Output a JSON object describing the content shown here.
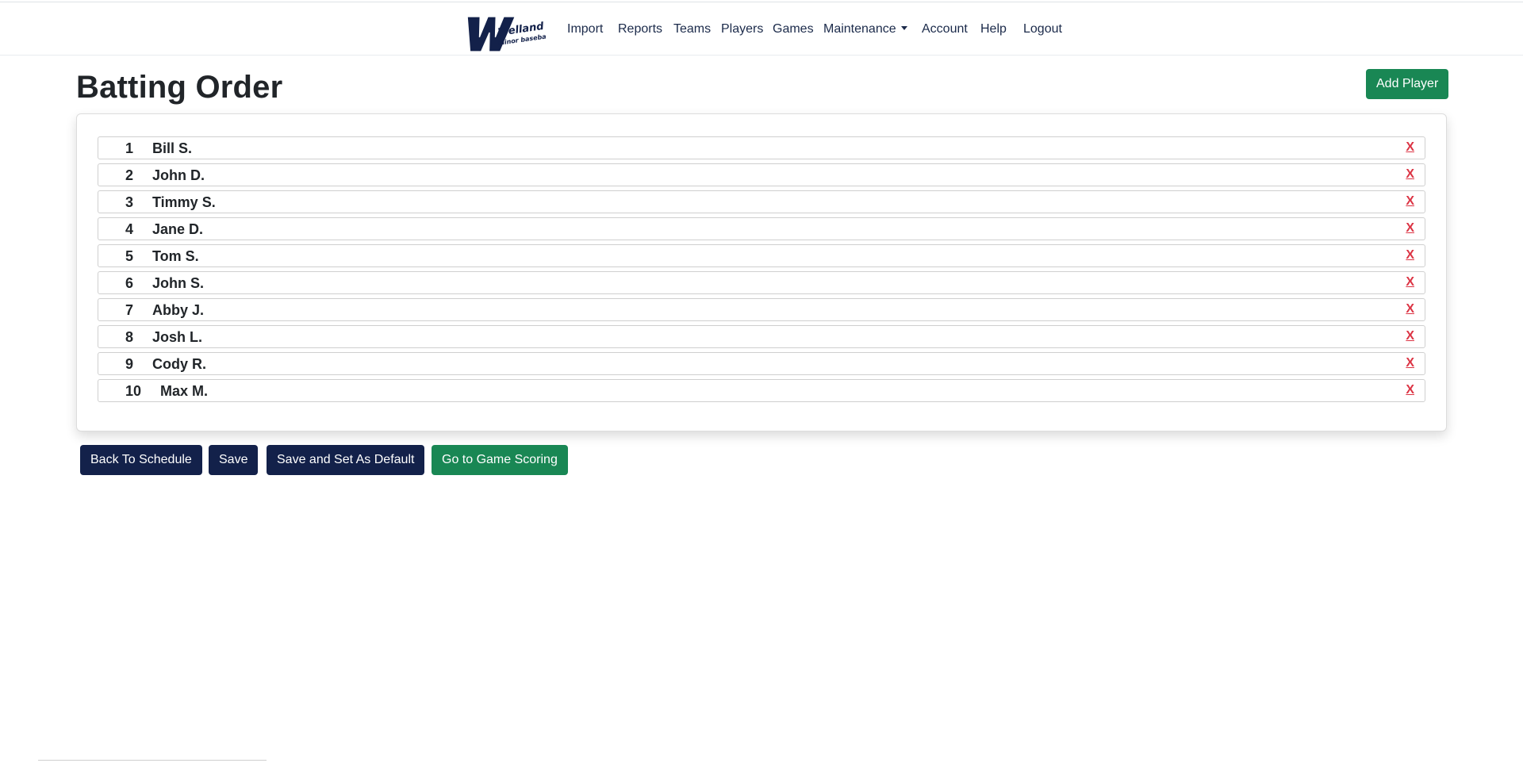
{
  "nav": {
    "items": [
      {
        "label": "Import",
        "name": "nav-import"
      },
      {
        "label": "Reports",
        "name": "nav-reports"
      },
      {
        "label": "Teams",
        "name": "nav-teams"
      },
      {
        "label": "Players",
        "name": "nav-players"
      },
      {
        "label": "Games",
        "name": "nav-games"
      },
      {
        "label": "Maintenance",
        "name": "nav-maintenance",
        "dropdown": true
      },
      {
        "label": "Account",
        "name": "nav-account"
      },
      {
        "label": "Help",
        "name": "nav-help"
      },
      {
        "label": "Logout",
        "name": "nav-logout"
      }
    ]
  },
  "logo": {
    "wordmark": "Welland",
    "tagline": "minor baseball"
  },
  "page": {
    "title": "Batting Order"
  },
  "buttons": {
    "add_player": "Add Player",
    "back_to_schedule": "Back To Schedule",
    "save": "Save",
    "save_default": "Save and Set As Default",
    "game_scoring": "Go to Game Scoring"
  },
  "batting_order": [
    {
      "number": "1",
      "name": "Bill S.",
      "remove": "X"
    },
    {
      "number": "2",
      "name": "John D.",
      "remove": "X"
    },
    {
      "number": "3",
      "name": "Timmy S.",
      "remove": "X"
    },
    {
      "number": "4",
      "name": "Jane D.",
      "remove": "X"
    },
    {
      "number": "5",
      "name": "Tom S.",
      "remove": "X"
    },
    {
      "number": "6",
      "name": "John S.",
      "remove": "X"
    },
    {
      "number": "7",
      "name": "Abby J.",
      "remove": "X"
    },
    {
      "number": "8",
      "name": "Josh L.",
      "remove": "X"
    },
    {
      "number": "9",
      "name": "Cody R.",
      "remove": "X"
    },
    {
      "number": "10",
      "name": "Max M.",
      "remove": "X"
    }
  ],
  "colors": {
    "primary_navy": "#13214a",
    "success_green": "#198754",
    "danger_red": "#dc3545"
  }
}
